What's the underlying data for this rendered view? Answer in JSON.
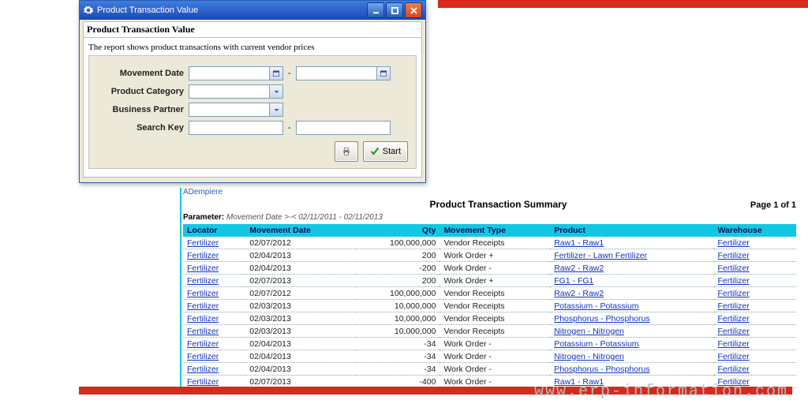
{
  "window": {
    "title": "Product Transaction Value",
    "doc_title": "Product Transaction Value",
    "description": "The report shows product transactions with current vendor prices",
    "fields": {
      "movement_date": "Movement Date",
      "product_category": "Product Category",
      "business_partner": "Business Partner",
      "search_key": "Search Key"
    },
    "start_label": "Start"
  },
  "report": {
    "app": "ADempiere",
    "title": "Product Transaction Summary",
    "page": "Page 1 of 1",
    "param_label": "Parameter:",
    "param_detail": "Movement Date  >-<  02/11/2011 - 02/11/2013",
    "columns": [
      "Locator",
      "Movement Date",
      "Qty",
      "Movement Type",
      "Product",
      "Warehouse"
    ],
    "rows": [
      {
        "loc": "Fertilizer",
        "date": "02/07/2012",
        "qty": "100,000,000",
        "type": "Vendor Receipts",
        "prod": "Raw1 - Raw1",
        "wh": "Fertilizer"
      },
      {
        "loc": "Fertilizer",
        "date": "02/04/2013",
        "qty": "200",
        "type": "Work Order +",
        "prod": "Fertilizer - Lawn Fertilizer",
        "wh": "Fertilizer"
      },
      {
        "loc": "Fertilizer",
        "date": "02/04/2013",
        "qty": "-200",
        "type": "Work Order -",
        "prod": "Raw2 - Raw2",
        "wh": "Fertilizer"
      },
      {
        "loc": "Fertilizer",
        "date": "02/07/2013",
        "qty": "200",
        "type": "Work Order +",
        "prod": "FG1 - FG1",
        "wh": "Fertilizer"
      },
      {
        "loc": "Fertilizer",
        "date": "02/07/2012",
        "qty": "100,000,000",
        "type": "Vendor Receipts",
        "prod": "Raw2 - Raw2",
        "wh": "Fertilizer"
      },
      {
        "loc": "Fertilizer",
        "date": "02/03/2013",
        "qty": "10,000,000",
        "type": "Vendor Receipts",
        "prod": "Potassium - Potassium",
        "wh": "Fertilizer"
      },
      {
        "loc": "Fertilizer",
        "date": "02/03/2013",
        "qty": "10,000,000",
        "type": "Vendor Receipts",
        "prod": "Phosphorus - Phosphorus",
        "wh": "Fertilizer"
      },
      {
        "loc": "Fertilizer",
        "date": "02/03/2013",
        "qty": "10,000,000",
        "type": "Vendor Receipts",
        "prod": "Nitrogen - Nitrogen",
        "wh": "Fertilizer"
      },
      {
        "loc": "Fertilizer",
        "date": "02/04/2013",
        "qty": "-34",
        "type": "Work Order -",
        "prod": "Potassium - Potassium",
        "wh": "Fertilizer"
      },
      {
        "loc": "Fertilizer",
        "date": "02/04/2013",
        "qty": "-34",
        "type": "Work Order -",
        "prod": "Nitrogen - Nitrogen",
        "wh": "Fertilizer"
      },
      {
        "loc": "Fertilizer",
        "date": "02/04/2013",
        "qty": "-34",
        "type": "Work Order -",
        "prod": "Phosphorus - Phosphorus",
        "wh": "Fertilizer"
      },
      {
        "loc": "Fertilizer",
        "date": "02/07/2013",
        "qty": "-400",
        "type": "Work Order -",
        "prod": "Raw1 - Raw1",
        "wh": "Fertilizer"
      }
    ]
  },
  "watermark": "www.erp-information.com"
}
